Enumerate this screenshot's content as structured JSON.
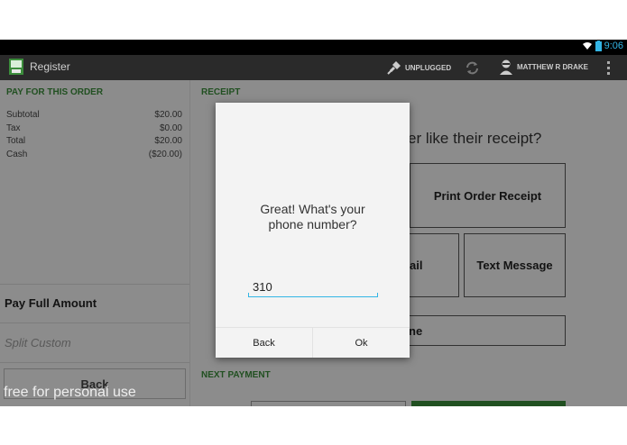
{
  "status_bar": {
    "time": "9:06",
    "wifi_icon": "wifi-icon",
    "battery_icon": "battery-icon"
  },
  "action_bar": {
    "app_title": "Register",
    "connection_status": "UNPLUGGED",
    "user_name": "MATTHEW R DRAKE"
  },
  "left_panel": {
    "title": "PAY FOR THIS ORDER",
    "totals": [
      {
        "label": "Subtotal",
        "value": "$20.00"
      },
      {
        "label": "Tax",
        "value": "$0.00"
      },
      {
        "label": "Total",
        "value": "$20.00"
      },
      {
        "label": "Cash",
        "value": "($20.00)"
      }
    ],
    "pay_full_amount": "Pay Full Amount",
    "split_custom": "Split Custom",
    "back_label": "Back"
  },
  "right_panel": {
    "receipt_title": "RECEIPT",
    "receipt_question": "er like their receipt?",
    "print_order_receipt": "Print Order Receipt",
    "email_label": "ail",
    "text_message": "Text Message",
    "none_label": "ne",
    "next_payment_title": "NEXT PAYMENT"
  },
  "dialog": {
    "message": "Great! What's your phone number?",
    "phone_value": "310",
    "back_label": "Back",
    "ok_label": "Ok"
  },
  "watermark": "free for personal use",
  "colors": {
    "accent_green": "#3a8a3a",
    "input_underline": "#33b5e5",
    "action_bar": "#2a2a2a"
  }
}
